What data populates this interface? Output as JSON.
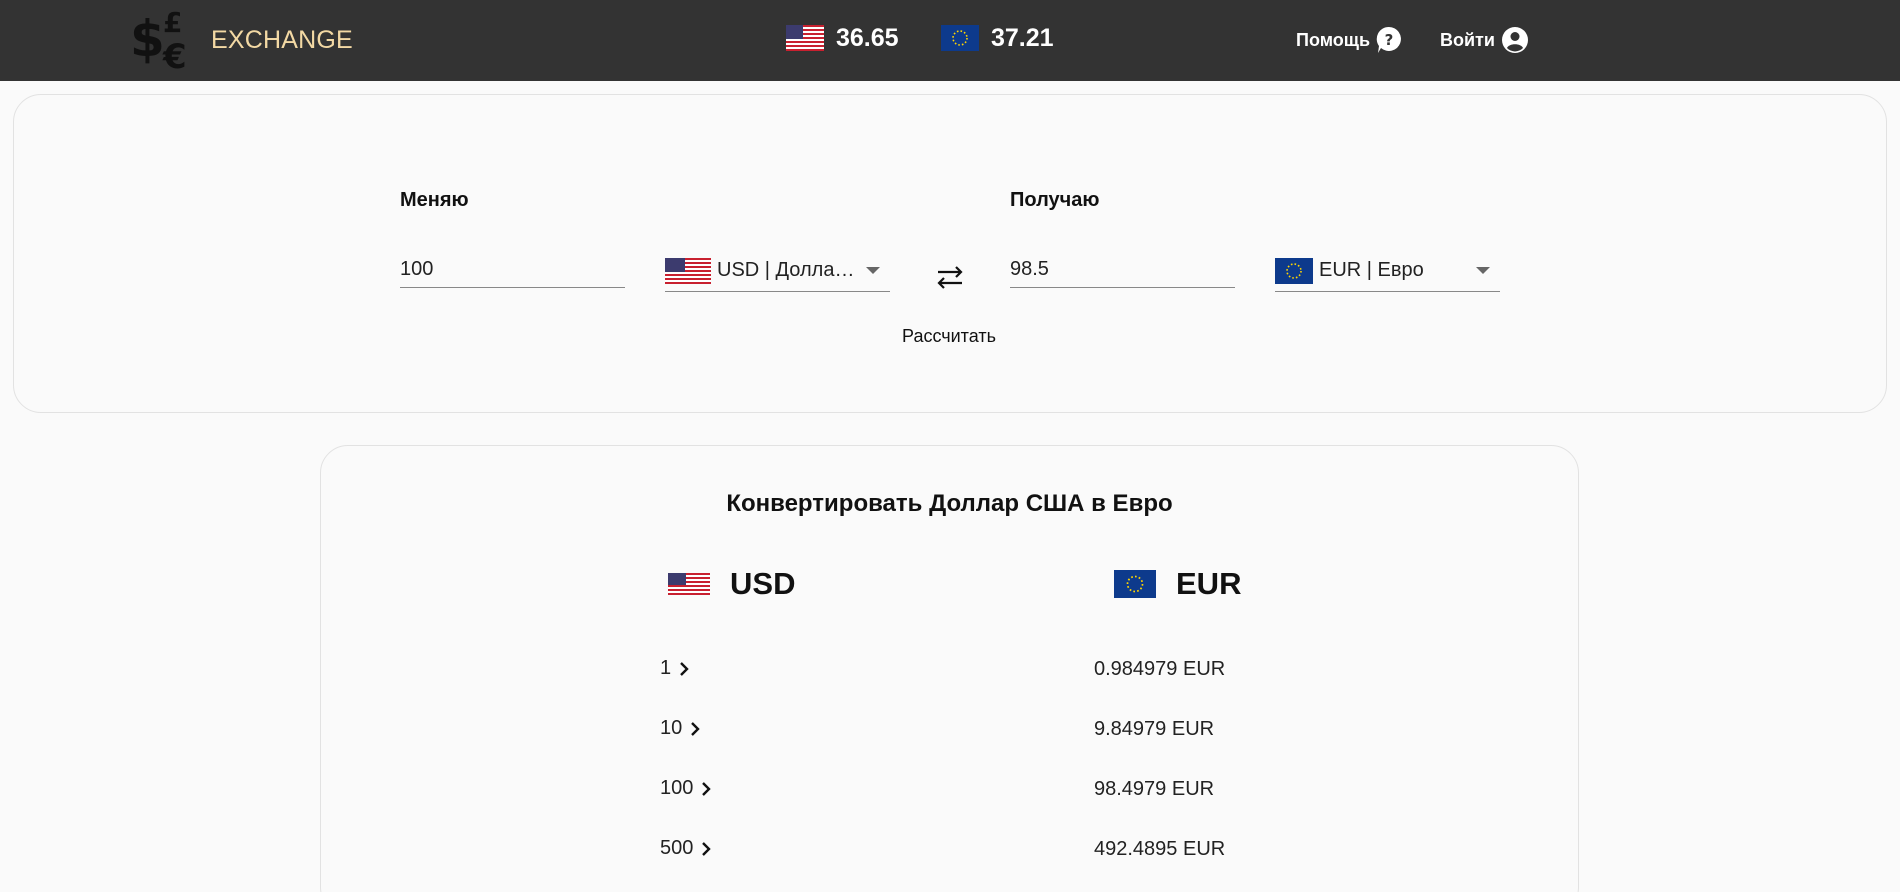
{
  "header": {
    "brand": "EXCHANGE",
    "rates": [
      {
        "flag": "us-flag-icon",
        "value": "36.65"
      },
      {
        "flag": "eu-flag-icon",
        "value": "37.21"
      }
    ],
    "help_label": "Помощь",
    "login_label": "Войти"
  },
  "converter": {
    "from_label": "Меняю",
    "to_label": "Получаю",
    "from_amount": "100",
    "to_amount": "98.5",
    "from_currency": "USD | Доллар США",
    "to_currency": "EUR | Евро",
    "calculate_label": "Рассчитать"
  },
  "table": {
    "title": "Конвертировать Доллар США в Евро",
    "from_code": "USD",
    "to_code": "EUR",
    "rows": [
      {
        "from": "1",
        "to": "0.984979 EUR"
      },
      {
        "from": "10",
        "to": "9.84979 EUR"
      },
      {
        "from": "100",
        "to": "98.4979 EUR"
      },
      {
        "from": "500",
        "to": "492.4895 EUR"
      }
    ]
  },
  "colors": {
    "header_bg": "#333333",
    "brand": "#f3d9a4",
    "page_bg": "#fafafa"
  }
}
